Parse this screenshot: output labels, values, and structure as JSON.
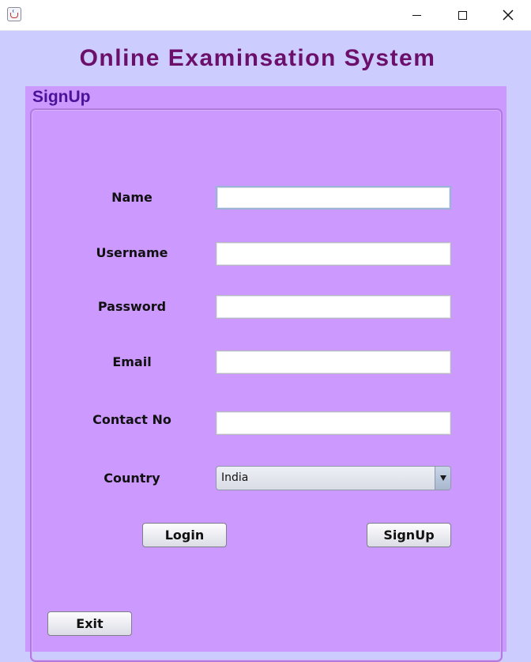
{
  "window": {
    "app_icon": "java-cup-icon",
    "controls": {
      "minimize": "minimize-icon",
      "maximize": "maximize-icon",
      "close": "close-icon"
    }
  },
  "app_title": "Online Examinsation System",
  "panel": {
    "title": "SignUp"
  },
  "form": {
    "name": {
      "label": "Name",
      "value": ""
    },
    "username": {
      "label": "Username",
      "value": ""
    },
    "password": {
      "label": "Password",
      "value": ""
    },
    "email": {
      "label": "Email",
      "value": ""
    },
    "contact_no": {
      "label": "Contact No",
      "value": ""
    },
    "country": {
      "label": "Country",
      "selected": "India"
    }
  },
  "buttons": {
    "login": "Login",
    "signup": "SignUp",
    "exit": "Exit"
  },
  "colors": {
    "background": "#ccccff",
    "panel": "#cc99ff",
    "title_text": "#6b0f6b",
    "panel_title_text": "#4a1299"
  }
}
